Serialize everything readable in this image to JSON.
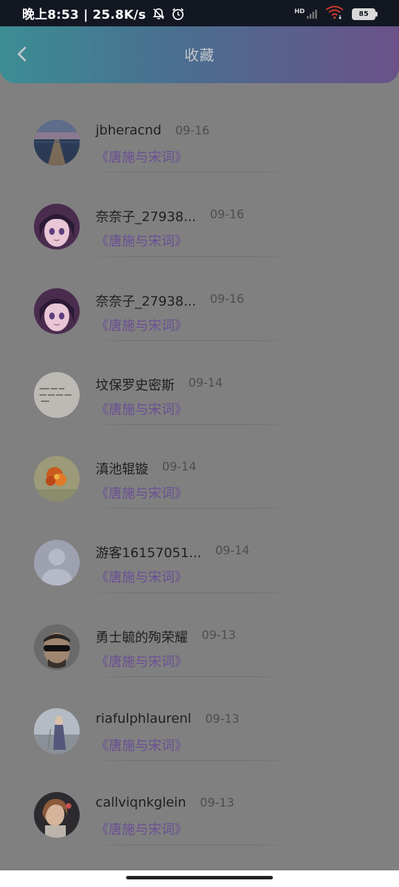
{
  "status_bar": {
    "time_speed": "晚上8:53 | 25.8K/s",
    "network_label": "HD",
    "battery_level": "85"
  },
  "header": {
    "title": "收藏",
    "back_icon": "chevron-left-icon"
  },
  "favorites": [
    {
      "name": "jbheracnd",
      "date": "09-16",
      "work": "《唐施与宋词》",
      "avatar": "landscape-pier"
    },
    {
      "name": "奈奈子_27938...",
      "date": "09-16",
      "work": "《唐施与宋词》",
      "avatar": "anime-girl"
    },
    {
      "name": "奈奈子_27938...",
      "date": "09-16",
      "work": "《唐施与宋词》",
      "avatar": "anime-girl"
    },
    {
      "name": "坟保罗史密斯",
      "date": "09-14",
      "work": "《唐施与宋词》",
      "avatar": "handwriting"
    },
    {
      "name": "滇池辊镟",
      "date": "09-14",
      "work": "《唐施与宋词》",
      "avatar": "orange-flower"
    },
    {
      "name": "游客16157051...",
      "date": "09-14",
      "work": "《唐施与宋词》",
      "avatar": "default-user"
    },
    {
      "name": "勇士毓的殉荣耀",
      "date": "09-13",
      "work": "《唐施与宋词》",
      "avatar": "man-sunglasses"
    },
    {
      "name": "riafulphlaurenl",
      "date": "09-13",
      "work": "《唐施与宋词》",
      "avatar": "woman-beach"
    },
    {
      "name": "callviqnkglein",
      "date": "09-13",
      "work": "《唐施与宋词》",
      "avatar": "woman-portrait"
    }
  ]
}
